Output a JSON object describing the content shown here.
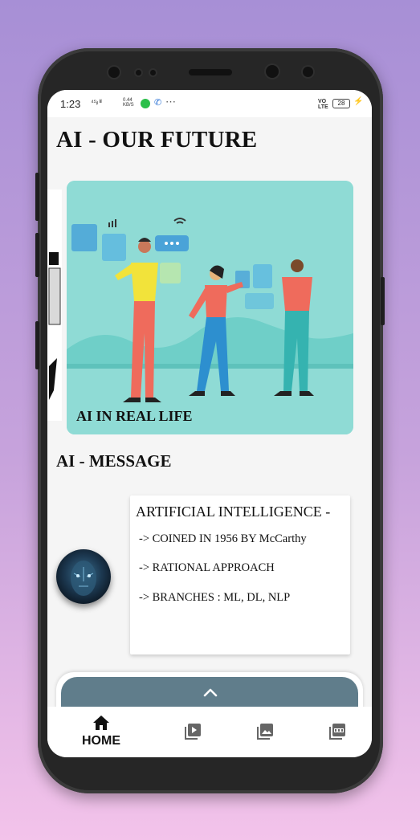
{
  "status_bar": {
    "time": "1:23",
    "signal_text": "⁴⁵ᵢₗ ˡᶦˡ",
    "speed_value": "0.44",
    "speed_unit": "KB/S",
    "volte_top": "VO",
    "volte_bottom": "LTE",
    "battery": "28",
    "icons": [
      "whatsapp-icon",
      "phone-icon",
      "more-icon",
      "battery-icon",
      "charging-icon"
    ]
  },
  "header": {
    "title": "AI - OUR FUTURE"
  },
  "carousel": {
    "caption": "AI IN REAL LIFE"
  },
  "message_section": {
    "title": "AI - MESSAGE",
    "card": {
      "heading": "ARTIFICIAL INTELLIGENCE -",
      "lines": [
        "-> COINED IN 1956 BY McCarthy",
        "-> RATIONAL APPROACH",
        "-> BRANCHES : ML, DL, NLP"
      ]
    }
  },
  "bottom_nav": {
    "items": [
      {
        "label": "HOME",
        "icon": "home-icon",
        "active": true
      },
      {
        "label": "",
        "icon": "video-library-icon"
      },
      {
        "label": "",
        "icon": "photo-library-icon"
      },
      {
        "label": "",
        "icon": "pdf-icon"
      }
    ]
  },
  "colors": {
    "background_top": "#a78fd6",
    "background_bottom": "#f3c3ea",
    "card_teal": "#8fdbd5",
    "sheet_handle": "#607d8b"
  }
}
